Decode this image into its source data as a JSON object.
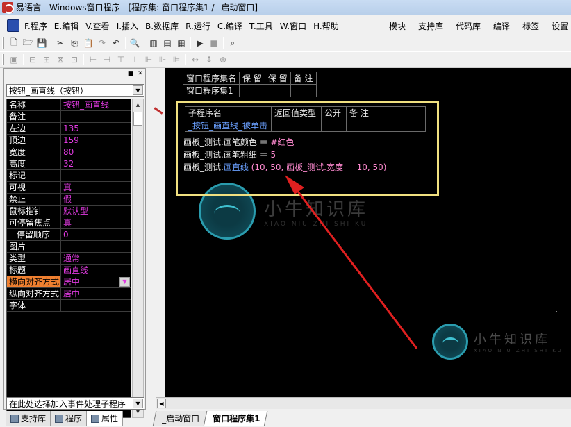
{
  "window": {
    "title": "易语言 - Windows窗口程序 - [程序集: 窗口程序集1 / _启动窗口]"
  },
  "menu": {
    "items": [
      "F.程序",
      "E.编辑",
      "V.查看",
      "I.插入",
      "B.数据库",
      "R.运行",
      "C.编译",
      "T.工具",
      "W.窗口",
      "H.帮助"
    ],
    "right_items": [
      "模块",
      "支持库",
      "代码库",
      "编译",
      "标签",
      "设置"
    ]
  },
  "toolbar1": {
    "buttons": [
      "new-file-icon",
      "open-folder-icon",
      "save-icon",
      "cut-icon",
      "copy-icon",
      "paste-icon",
      "redo-icon",
      "undo-icon",
      "find-icon",
      "layout-left-icon",
      "layout-top-icon",
      "layout-split-icon",
      "run-icon",
      "stop-icon",
      "binoculars-icon"
    ],
    "glyphs": [
      "🗋",
      "🗁",
      "💾",
      "✂",
      "⎘",
      "📋",
      "↷",
      "↶",
      "🔍",
      "▥",
      "▤",
      "▦",
      "▶",
      "■",
      "⌕"
    ]
  },
  "toolbar2": {
    "glyphs": [
      "▣",
      "⊟",
      "⊞",
      "⊠",
      "⊡",
      "⊢",
      "⊣",
      "⊤",
      "⊥",
      "⊩",
      "⊪",
      "⊫",
      "↔",
      "↕",
      "⊕"
    ]
  },
  "left_panel": {
    "object_selector": "按钮_画直线（按钮）",
    "properties": [
      {
        "name": "名称",
        "value": "按钮_画直线"
      },
      {
        "name": "备注",
        "value": ""
      },
      {
        "name": "左边",
        "value": "135"
      },
      {
        "name": "顶边",
        "value": "159"
      },
      {
        "name": "宽度",
        "value": "80"
      },
      {
        "name": "高度",
        "value": "32"
      },
      {
        "name": "标记",
        "value": ""
      },
      {
        "name": "可视",
        "value": "真"
      },
      {
        "name": "禁止",
        "value": "假"
      },
      {
        "name": "鼠标指针",
        "value": "默认型"
      },
      {
        "name": "可停留焦点",
        "value": "真"
      },
      {
        "name": "停留顺序",
        "value": "0"
      },
      {
        "name": "图片",
        "value": ""
      },
      {
        "name": "类型",
        "value": "通常"
      },
      {
        "name": "标题",
        "value": "画直线"
      },
      {
        "name": "横向对齐方式",
        "value": "居中"
      },
      {
        "name": "纵向对齐方式",
        "value": "居中"
      },
      {
        "name": "字体",
        "value": ""
      }
    ],
    "event_selector": "在此处选择加入事件处理子程序",
    "tabs": [
      "支持库",
      "程序",
      "属性"
    ]
  },
  "editor": {
    "assembly_table": {
      "headers": [
        "窗口程序集名",
        "保 留",
        "保 留",
        "备 注"
      ],
      "row": [
        "窗口程序集1",
        "",
        "",
        ""
      ]
    },
    "sub_table": {
      "headers": [
        "子程序名",
        "返回值类型",
        "公开",
        "备 注"
      ],
      "row": [
        "_按钮_画直线_被单击",
        "",
        "",
        ""
      ]
    },
    "code_lines": [
      {
        "prefix": "画板_测试.",
        "hl": "画笔颜色",
        "rest": " ＝ ",
        "value": "#红色"
      },
      {
        "prefix": "画板_测试.",
        "hl": "画笔粗细",
        "rest": " ＝ ",
        "value": "5"
      },
      {
        "prefix": "画板_测试.",
        "hl": "画直线",
        "rest": " (10, 50, 画板_测试.宽度 － 10, 50)",
        "value": ""
      }
    ],
    "watermark": {
      "title": "小牛知识库",
      "subtitle": "XIAO NIU ZHI SHI KU"
    },
    "tabs": [
      "_启动窗口",
      "窗口程序集1"
    ]
  },
  "colors": {
    "editor_bg": "#000000",
    "highlight_box": "#f0e080",
    "arrow": "#e02020",
    "property_value": "#e03ae0",
    "keyword": "#6aa0ff"
  }
}
